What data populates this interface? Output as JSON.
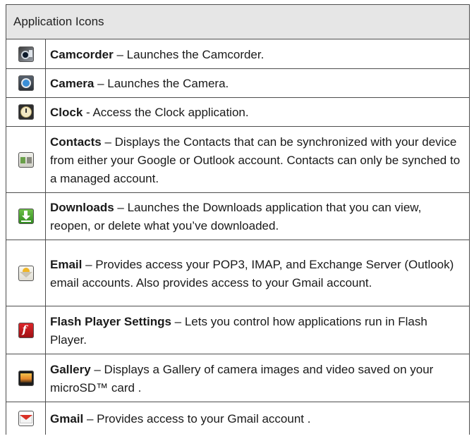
{
  "header": {
    "title": "Application Icons"
  },
  "rows": [
    {
      "icon": "camcorder-icon",
      "name": "Camcorder",
      "desc": " – Launches the Camcorder."
    },
    {
      "icon": "camera-icon",
      "name": "Camera",
      "desc": " – Launches the Camera."
    },
    {
      "icon": "clock-icon",
      "name": "Clock",
      "desc": " - Access the Clock application."
    },
    {
      "icon": "contacts-icon",
      "name": "Contacts",
      "desc": " – Displays the Contacts that can be synchronized with your device from either your Google or Outlook account. Contacts can only be synched to a managed account."
    },
    {
      "icon": "downloads-icon",
      "name": "Downloads",
      "desc": " – Launches the Downloads application that you can view, reopen, or delete what you’ve downloaded."
    },
    {
      "icon": "email-icon",
      "name": "Email",
      "desc": " – Provides access your POP3, IMAP, and Exchange Server (Outlook) email accounts. Also provides access to your Gmail account."
    },
    {
      "icon": "flash-player-icon",
      "name": "Flash Player Settings",
      "desc": " – Lets you control how applications run in Flash Player."
    },
    {
      "icon": "gallery-icon",
      "name": "Gallery",
      "desc": " – Displays a Gallery of camera images and video saved on your microSD™ card ."
    },
    {
      "icon": "gmail-icon",
      "name": "Gmail",
      "desc": " – Provides access to your Gmail account ."
    }
  ]
}
